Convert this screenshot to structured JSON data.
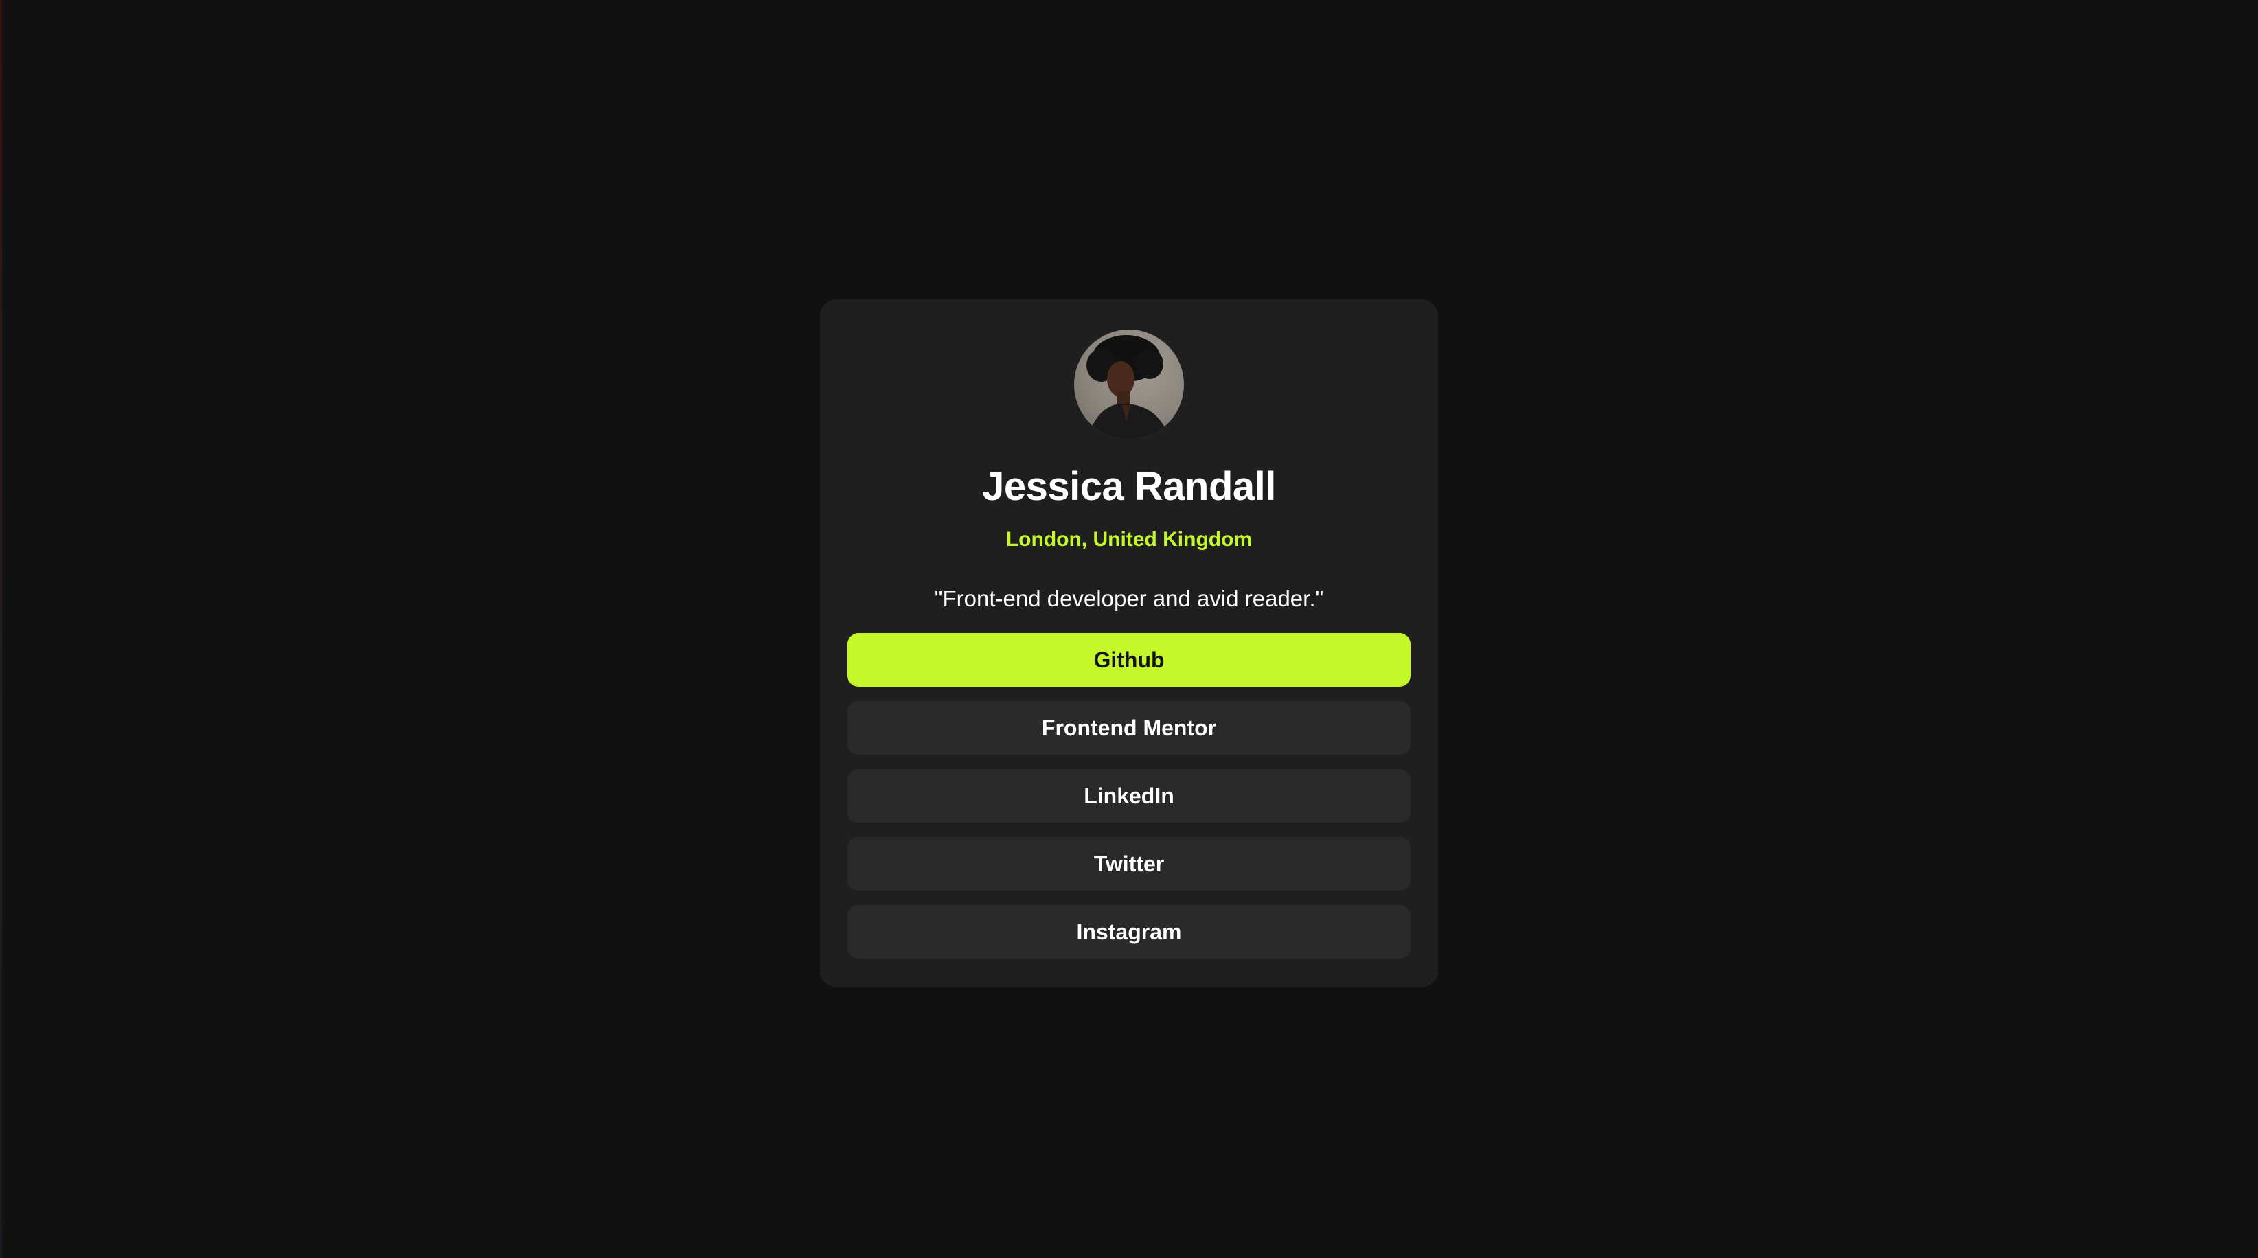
{
  "profile": {
    "name": "Jessica Randall",
    "location": "London, United Kingdom",
    "bio": "\"Front-end developer and avid reader.\""
  },
  "links": [
    {
      "label": "Github",
      "active": true
    },
    {
      "label": "Frontend Mentor",
      "active": false
    },
    {
      "label": "LinkedIn",
      "active": false
    },
    {
      "label": "Twitter",
      "active": false
    },
    {
      "label": "Instagram",
      "active": false
    }
  ],
  "colors": {
    "background": "#111111",
    "card": "#1f1f1f",
    "button": "#2a2a2a",
    "accent": "#c4f82a",
    "text": "#ffffff"
  }
}
